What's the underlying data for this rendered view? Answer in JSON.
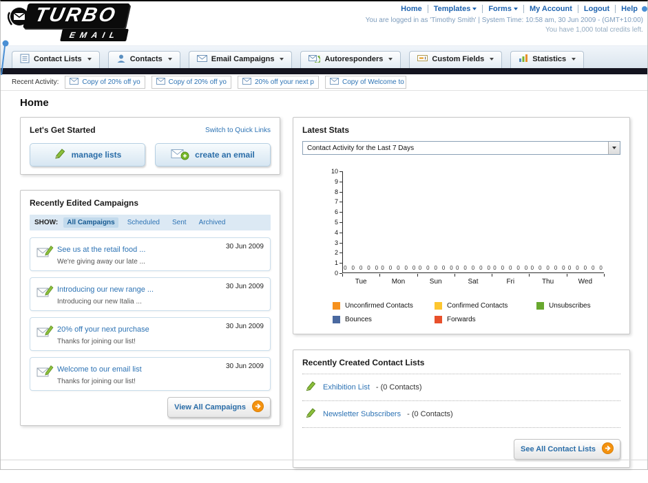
{
  "header": {
    "logo_primary": "TURBO",
    "logo_secondary": "EMAIL",
    "nav_links": [
      "Home",
      "Templates",
      "Forms",
      "My Account",
      "Logout",
      "Help"
    ],
    "login_text": "You are logged in as 'Timothy Smith' | System Time: 10:58 am, 30 Jun 2009 - (GMT+10:00)",
    "credits_text": "You have 1,000 total credits left."
  },
  "nav_tabs": [
    {
      "label": "Contact Lists"
    },
    {
      "label": "Contacts"
    },
    {
      "label": "Email Campaigns"
    },
    {
      "label": "Autoresponders"
    },
    {
      "label": "Custom Fields"
    },
    {
      "label": "Statistics"
    }
  ],
  "recent_activity": {
    "label": "Recent Activity:",
    "items": [
      "Copy of 20% off yo",
      "Copy of 20% off yo",
      "20% off your next p",
      "Copy of Welcome to"
    ]
  },
  "page": {
    "title": "Home"
  },
  "get_started": {
    "title": "Let's Get Started",
    "switch_link": "Switch to Quick Links",
    "manage_lists_label": "manage lists",
    "create_email_label": "create an email"
  },
  "campaigns": {
    "title": "Recently Edited Campaigns",
    "show_label": "SHOW:",
    "filters": [
      "All Campaigns",
      "Scheduled",
      "Sent",
      "Archived"
    ],
    "active_filter": "All Campaigns",
    "items": [
      {
        "title": "See us at the retail food ...",
        "subtitle": "We're giving away our late ...",
        "date": "30 Jun 2009"
      },
      {
        "title": "Introducing our new range ...",
        "subtitle": "Introducing our new Italia ...",
        "date": "30 Jun 2009"
      },
      {
        "title": "20% off your next purchase",
        "subtitle": "Thanks for joining our list!",
        "date": "30 Jun 2009"
      },
      {
        "title": "Welcome to our email list",
        "subtitle": "Thanks for joining our list!",
        "date": "30 Jun 2009"
      }
    ],
    "view_all_label": "View All Campaigns"
  },
  "stats": {
    "title": "Latest Stats",
    "period_selected": "Contact Activity for the Last 7 Days",
    "chart_data": {
      "type": "bar",
      "title": "Contact Activity for the Last 7 Days",
      "categories": [
        "Tue",
        "Mon",
        "Sun",
        "Sat",
        "Fri",
        "Thu",
        "Wed"
      ],
      "series": [
        {
          "name": "Unconfirmed Contacts",
          "color": "#F6911E",
          "values": [
            0,
            0,
            0,
            0,
            0,
            0,
            0
          ]
        },
        {
          "name": "Confirmed Contacts",
          "color": "#FDC62F",
          "values": [
            0,
            0,
            0,
            0,
            0,
            0,
            0
          ]
        },
        {
          "name": "Unsubscribes",
          "color": "#68A82E",
          "values": [
            0,
            0,
            0,
            0,
            0,
            0,
            0
          ]
        },
        {
          "name": "Bounces",
          "color": "#4A69A0",
          "values": [
            0,
            0,
            0,
            0,
            0,
            0,
            0
          ]
        },
        {
          "name": "Forwards",
          "color": "#E8502B",
          "values": [
            0,
            0,
            0,
            0,
            0,
            0,
            0
          ]
        }
      ],
      "ylim": [
        0,
        10
      ],
      "grid": false,
      "legend_position": "bottom"
    }
  },
  "contact_lists": {
    "title": "Recently Created Contact Lists",
    "items": [
      {
        "name": "Exhibition List",
        "detail": "- (0 Contacts)"
      },
      {
        "name": "Newsletter Subscribers",
        "detail": "- (0 Contacts)"
      }
    ],
    "see_all_label": "See All Contact Lists"
  }
}
